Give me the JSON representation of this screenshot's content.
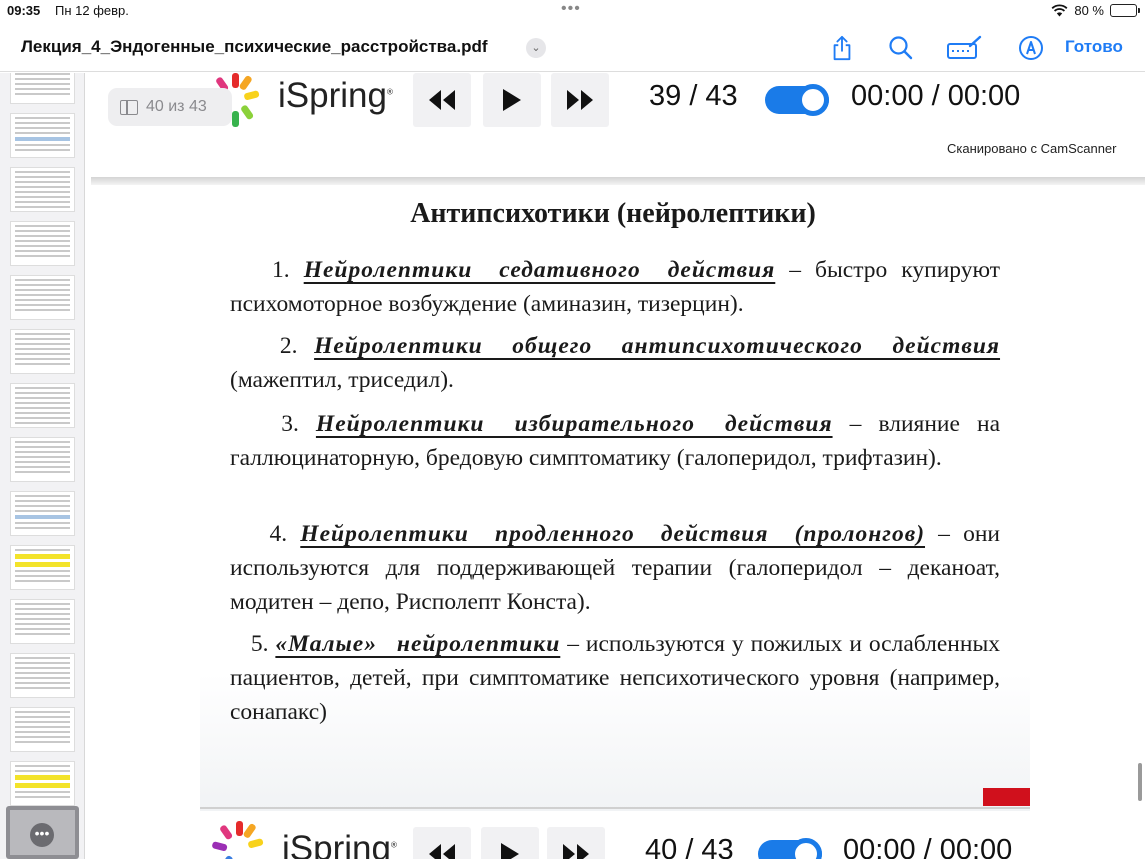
{
  "status_bar": {
    "time": "09:35",
    "date": "Пн 12 февр.",
    "battery": "80 %",
    "battery_level": 0.8,
    "multitask_dots": "•••"
  },
  "nav": {
    "title": "Лекция_4_Эндогенные_психические_расстройства.pdf",
    "done_label": "Готово",
    "accent_color": "#1f7cf5"
  },
  "page_indicator": {
    "label": "40 из 43"
  },
  "player_top": {
    "logo": "iSpring",
    "logo_mark": "®",
    "counter": "39 / 43",
    "timer": "00:00 / 00:00"
  },
  "player_bottom": {
    "logo": "iSpring",
    "logo_mark": "®",
    "counter": "40 / 43",
    "timer": "00:00 / 00:00"
  },
  "scan_note": "Сканировано с CamScanner",
  "slide": {
    "title": "Антипсихотики (нейролептики)",
    "items": [
      {
        "num": "1.",
        "term": "Нейролептики седативного действия",
        "text": " – быстро купируют психомоторное возбуждение (аминазин, тизерцин)."
      },
      {
        "num": "2.",
        "term": "Нейролептики общего антипсихотического действия",
        "text": " (мажептил, триседил)."
      },
      {
        "num": "3.",
        "term": "Нейролептики избирательного действия",
        "text": " – влияние на галлюцинаторную, бредовую симптоматику (галоперидол, трифтазин)."
      },
      {
        "num": "4.",
        "term": "Нейролептики продленного действия (пролонгов)",
        "text": " – они используются для поддерживающей терапии (галоперидол – деканоат, модитен – депо, Рисполепт Конста)."
      },
      {
        "num": "5.",
        "term": "«Малые» нейролептики",
        "text": " – используются у пожилых и ослабленных пациентов, детей, при симптоматике непсихотического уровня (например, сонапакс)"
      }
    ]
  }
}
